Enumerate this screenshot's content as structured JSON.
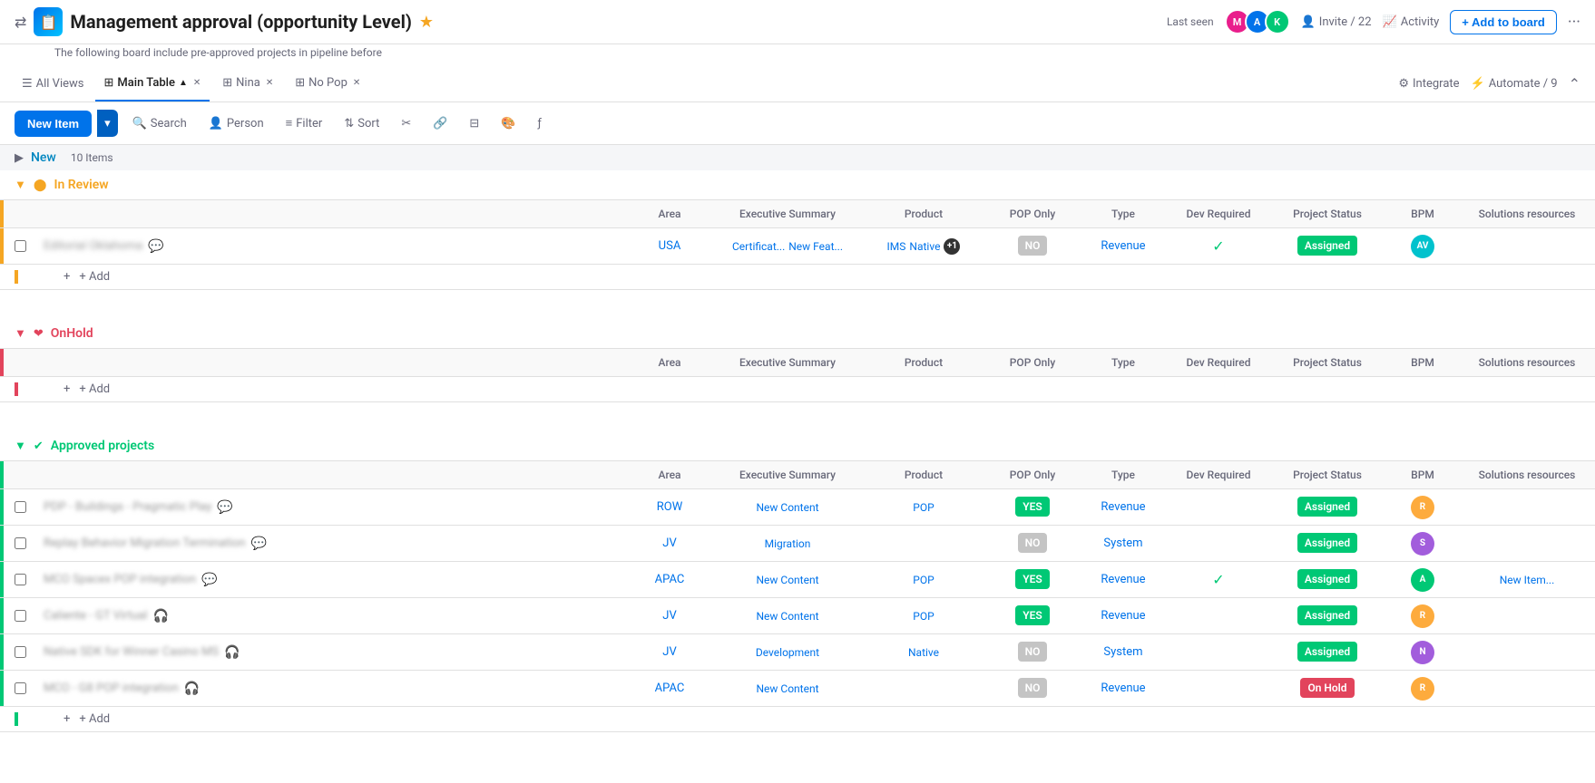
{
  "app": {
    "title": "Management approval (opportunity Level)",
    "subtitle": "The following board include pre-approved projects in pipeline before",
    "last_seen_text": "Last seen",
    "invite_label": "Invite / 22",
    "activity_label": "Activity",
    "add_board_label": "+ Add to board"
  },
  "views_bar": {
    "all_views_label": "All Views",
    "tabs": [
      {
        "label": "Main Table",
        "active": true
      },
      {
        "label": "Nina",
        "active": false
      },
      {
        "label": "No Pop",
        "active": false
      }
    ],
    "integrate_label": "Integrate",
    "automate_label": "Automate / 9"
  },
  "toolbar": {
    "new_item_label": "New Item",
    "search_label": "Search",
    "person_label": "Person",
    "filter_label": "Filter",
    "sort_label": "Sort"
  },
  "groups": {
    "new": {
      "label": "New",
      "count": "10 Items"
    },
    "in_review": {
      "label": "In Review",
      "columns": {
        "area": "Area",
        "exec": "Executive Summary",
        "product": "Product",
        "pop": "POP Only",
        "type": "Type",
        "dev": "Dev Required",
        "status": "Project Status",
        "bpm": "BPM",
        "solutions": "Solutions resources"
      },
      "rows": [
        {
          "name": "blurred name",
          "area": "USA",
          "exec": [
            "Certificat...",
            "New Feat..."
          ],
          "product": [
            "IMS",
            "Native"
          ],
          "product_badge": "+1",
          "pop": "NO",
          "type": "Revenue",
          "dev_check": true,
          "status": "Assigned",
          "bpm_initials": "AV",
          "bpm_color": "teal"
        }
      ],
      "add_label": "+ Add"
    },
    "onhold": {
      "label": "OnHold",
      "columns": {
        "area": "Area",
        "exec": "Executive Summary",
        "product": "Product",
        "pop": "POP Only",
        "type": "Type",
        "dev": "Dev Required",
        "status": "Project Status",
        "bpm": "BPM",
        "solutions": "Solutions resources"
      },
      "rows": [],
      "add_label": "+ Add"
    },
    "approved": {
      "label": "Approved projects",
      "columns": {
        "area": "Area",
        "exec": "Executive Summary",
        "product": "Product",
        "pop": "POP Only",
        "type": "Type",
        "dev": "Dev Required",
        "status": "Project Status",
        "bpm": "BPM",
        "solutions": "Solutions resources"
      },
      "rows": [
        {
          "name": "PDP - Buildings - Pragmatic Play",
          "area": "ROW",
          "exec": [
            "New Content"
          ],
          "product": [
            "POP"
          ],
          "pop": "YES",
          "type": "Revenue",
          "dev_check": false,
          "status": "Assigned",
          "bpm_color": "orange",
          "solutions": ""
        },
        {
          "name": "Replay Behavior Migration Termination",
          "area": "JV",
          "exec": [
            "Migration"
          ],
          "product": [],
          "pop": "NO",
          "type": "System",
          "dev_check": false,
          "status": "Assigned",
          "bpm_color": "purple",
          "solutions": ""
        },
        {
          "name": "MCO Spacex POP integration",
          "area": "APAC",
          "exec": [
            "New Content"
          ],
          "product": [
            "POP"
          ],
          "pop": "YES",
          "type": "Revenue",
          "dev_check": true,
          "status": "Assigned",
          "bpm_color": "green",
          "solutions": "New Item..."
        },
        {
          "name": "Caliente - GT Virtual",
          "area": "JV",
          "exec": [
            "New Content"
          ],
          "product": [
            "POP"
          ],
          "pop": "YES",
          "type": "Revenue",
          "dev_check": false,
          "status": "Assigned",
          "bpm_color": "orange",
          "solutions": ""
        },
        {
          "name": "Native SDK for Winner Casino MS",
          "area": "JV",
          "exec": [
            "Development"
          ],
          "product": [
            "Native"
          ],
          "pop": "NO",
          "type": "System",
          "dev_check": false,
          "status": "Assigned",
          "bpm_color": "purple",
          "solutions": ""
        },
        {
          "name": "MCO - G8 POP integration",
          "area": "APAC",
          "exec": [
            "New Content"
          ],
          "product": [],
          "pop": "NO",
          "type": "Revenue",
          "dev_check": false,
          "status": "On Hold",
          "bpm_color": "orange",
          "solutions": ""
        }
      ],
      "add_label": "+ Add"
    }
  }
}
